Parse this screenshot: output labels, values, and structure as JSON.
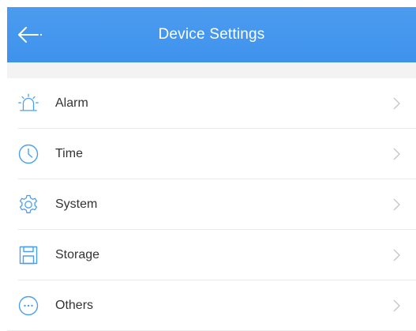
{
  "header": {
    "title": "Device Settings",
    "back_icon": "arrow-left-icon",
    "background": "#4299ee"
  },
  "colors": {
    "accent": "#4aa0f0",
    "text": "#333333",
    "chevron": "#c4c4c4",
    "divider": "#ebebeb",
    "section_gap": "#f3f3f3"
  },
  "menu": {
    "items": [
      {
        "label": "Alarm",
        "icon": "alarm-icon"
      },
      {
        "label": "Time",
        "icon": "clock-icon"
      },
      {
        "label": "System",
        "icon": "gear-icon"
      },
      {
        "label": "Storage",
        "icon": "storage-icon"
      },
      {
        "label": "Others",
        "icon": "more-icon"
      }
    ]
  }
}
